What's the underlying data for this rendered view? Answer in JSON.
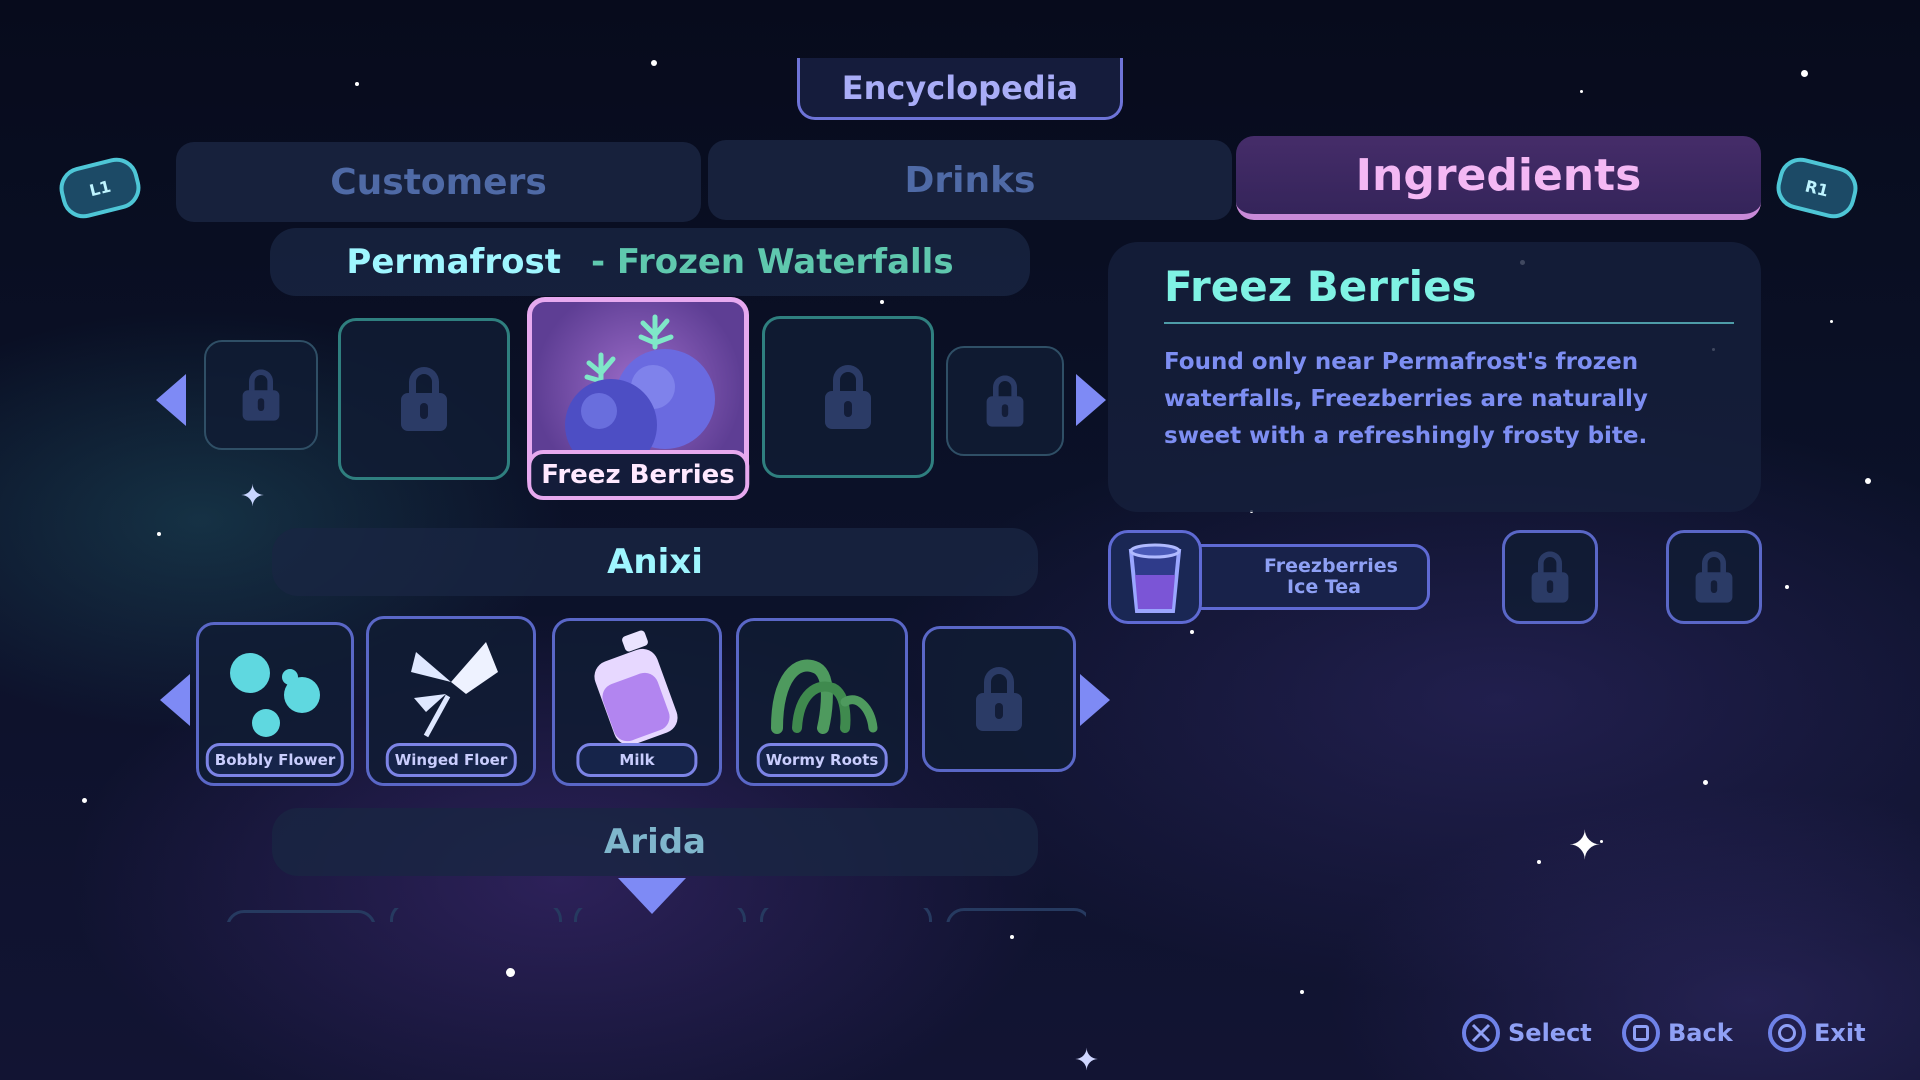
{
  "header": {
    "title": "Encyclopedia",
    "left_shoulder": "L1",
    "right_shoulder": "R1"
  },
  "tabs": [
    {
      "label": "Customers",
      "active": false
    },
    {
      "label": "Drinks",
      "active": false
    },
    {
      "label": "Ingredients",
      "active": true
    }
  ],
  "regions": [
    {
      "name": "Permafrost",
      "subtitle": "- Frozen Waterfalls",
      "selected_item": "Freez Berries"
    },
    {
      "name": "Anixi",
      "items": [
        "Bobbly Flower",
        "Winged Floer",
        "Milk",
        "Wormy Roots"
      ]
    },
    {
      "name": "Arida"
    }
  ],
  "detail": {
    "title": "Freez Berries",
    "description": "Found only near Permafrost's frozen waterfalls, Freezberries are naturally sweet with a refreshingly frosty bite.",
    "recipe_name": "Freezberries Ice Tea"
  },
  "prompts": {
    "select": "Select",
    "back": "Back",
    "exit": "Exit"
  },
  "colors": {
    "accent_teal": "#7ff3e4",
    "accent_pink": "#e7a9ef",
    "accent_blue": "#7e8af5"
  }
}
